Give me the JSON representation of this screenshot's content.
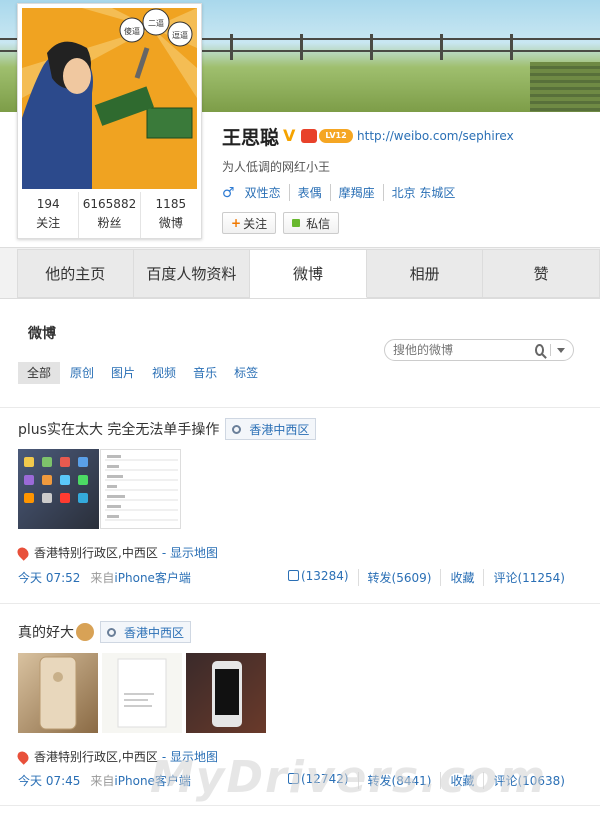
{
  "profile": {
    "name": "王思聪",
    "lv_badge": "LV12",
    "url": "http://weibo.com/sephirex",
    "bio": "为人低调的网红小王",
    "gender_icon": "♂",
    "tags": [
      "双性恋",
      "表偶",
      "摩羯座",
      "北京 东城区"
    ],
    "follow_label": "关注",
    "message_label": "私信",
    "stats": [
      {
        "num": "194",
        "label": "关注"
      },
      {
        "num": "6165882",
        "label": "粉丝"
      },
      {
        "num": "1185",
        "label": "微博"
      }
    ],
    "avatar_bubbles": [
      "傻逼",
      "二逼",
      "逗逼"
    ]
  },
  "tabs": [
    "他的主页",
    "百度人物资料",
    "微博",
    "相册",
    "赞"
  ],
  "active_tab": "微博",
  "feed": {
    "title": "微博",
    "search_placeholder": "搜他的微博",
    "filters": [
      "全部",
      "原创",
      "图片",
      "视频",
      "音乐",
      "标签"
    ]
  },
  "posts": [
    {
      "text": "plus实在太大 完全无法单手操作",
      "location_tag": "香港中西区",
      "geo": "香港特别行政区,中西区",
      "map_link": "- 显示地图",
      "time": "今天 07:52",
      "source_prefix": "来自",
      "client": "iPhone客户端",
      "likes": "(13284)",
      "repost": "转发(5609)",
      "fav": "收藏",
      "comments": "评论(11254)"
    },
    {
      "text": "真的好大",
      "location_tag": "香港中西区",
      "geo": "香港特别行政区,中西区",
      "map_link": "- 显示地图",
      "time": "今天 07:45",
      "source_prefix": "来自",
      "client": "iPhone客户端",
      "likes": "(12742)",
      "repost": "转发(8441)",
      "fav": "收藏",
      "comments": "评论(10638)"
    }
  ],
  "watermark": "MyDrivers.com",
  "colors": {
    "link": "#2a6fb5",
    "accent_orange": "#f07800",
    "avatar_bg": "#f0a321"
  }
}
